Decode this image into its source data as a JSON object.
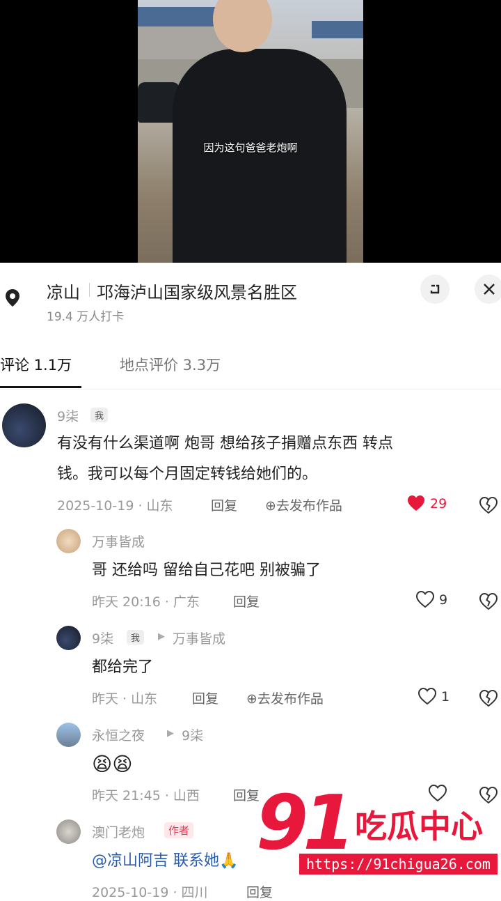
{
  "video": {
    "subtitle": "因为这句爸爸老炮啊"
  },
  "location": {
    "city": "凉山",
    "name": "邛海泸山国家级风景名胜区",
    "checkins": "19.4 万人打卡"
  },
  "tabs": [
    {
      "label": "评论 1.1万"
    },
    {
      "label": "地点评价 3.3万"
    }
  ],
  "comments": [
    {
      "user": "9柒",
      "badge": "我",
      "text_line1": "有没有什么渠道啊 炮哥 想给孩子捐赠点东西 转点",
      "text_line2": "钱。我可以每个月固定转钱给她们的。",
      "meta": "2025-10-19 · 山东",
      "reply": "回复",
      "publish": "去发布作品",
      "likes": "29"
    },
    {
      "user": "万事皆成",
      "text": "哥 还给吗 留给自己花吧 别被骗了",
      "meta": "昨天 20:16 · 广东",
      "reply": "回复",
      "likes": "9"
    },
    {
      "user": "9柒",
      "badge": "我",
      "reply_to": "万事皆成",
      "text": "都给完了",
      "meta": "昨天 · 山东",
      "reply": "回复",
      "publish": "去发布作品",
      "likes": "1"
    },
    {
      "user": "永恒之夜",
      "reply_to": "9柒",
      "text": "😫😫",
      "meta": "昨天 21:45 · 山西",
      "reply": "回复",
      "likes": ""
    },
    {
      "user": "澳门老炮",
      "badge": "作者",
      "text": "@凉山阿吉 联系她🙏",
      "meta": "2025-10-19 · 四川",
      "reply": "回复"
    }
  ],
  "watermark": {
    "number": "91",
    "text": "吃瓜中心",
    "url": "https://91chigua26.com"
  }
}
